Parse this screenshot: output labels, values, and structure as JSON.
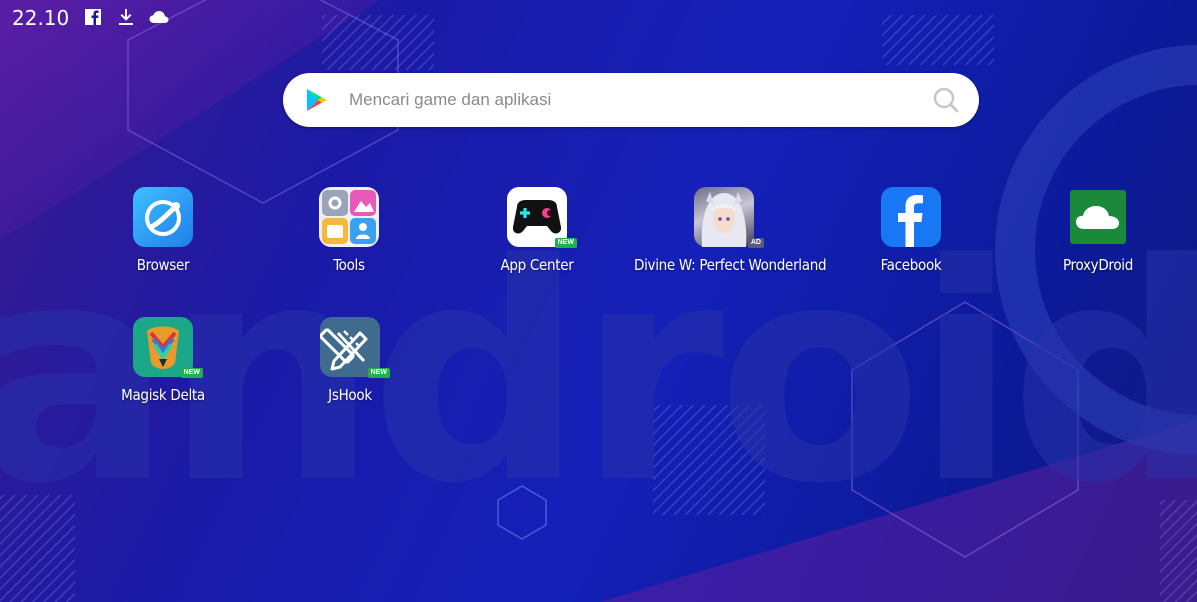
{
  "status_bar": {
    "time": "22.10",
    "icons": [
      "facebook-icon",
      "download-icon",
      "cloud-icon"
    ]
  },
  "search": {
    "placeholder": "Mencari game dan aplikasi",
    "icons": [
      "play-store-icon",
      "search-icon"
    ]
  },
  "wallpaper": {
    "text": "android"
  },
  "apps": [
    {
      "label": "Browser",
      "badge": ""
    },
    {
      "label": "Tools",
      "badge": ""
    },
    {
      "label": "App Center",
      "badge": "NEW"
    },
    {
      "label": "Divine W: Perfect Wonderland",
      "badge": "AD"
    },
    {
      "label": "Facebook",
      "badge": ""
    },
    {
      "label": "ProxyDroid",
      "badge": ""
    },
    {
      "label": "Magisk Delta",
      "badge": "NEW"
    },
    {
      "label": "JsHook",
      "badge": "NEW"
    }
  ],
  "colors": {
    "badge_new": "#1fb24a",
    "facebook_blue": "#1877f2",
    "proxydroid_green": "#1a8a3a",
    "magisk_teal": "#1aa889",
    "jshook_slate": "#3f6b8f"
  }
}
